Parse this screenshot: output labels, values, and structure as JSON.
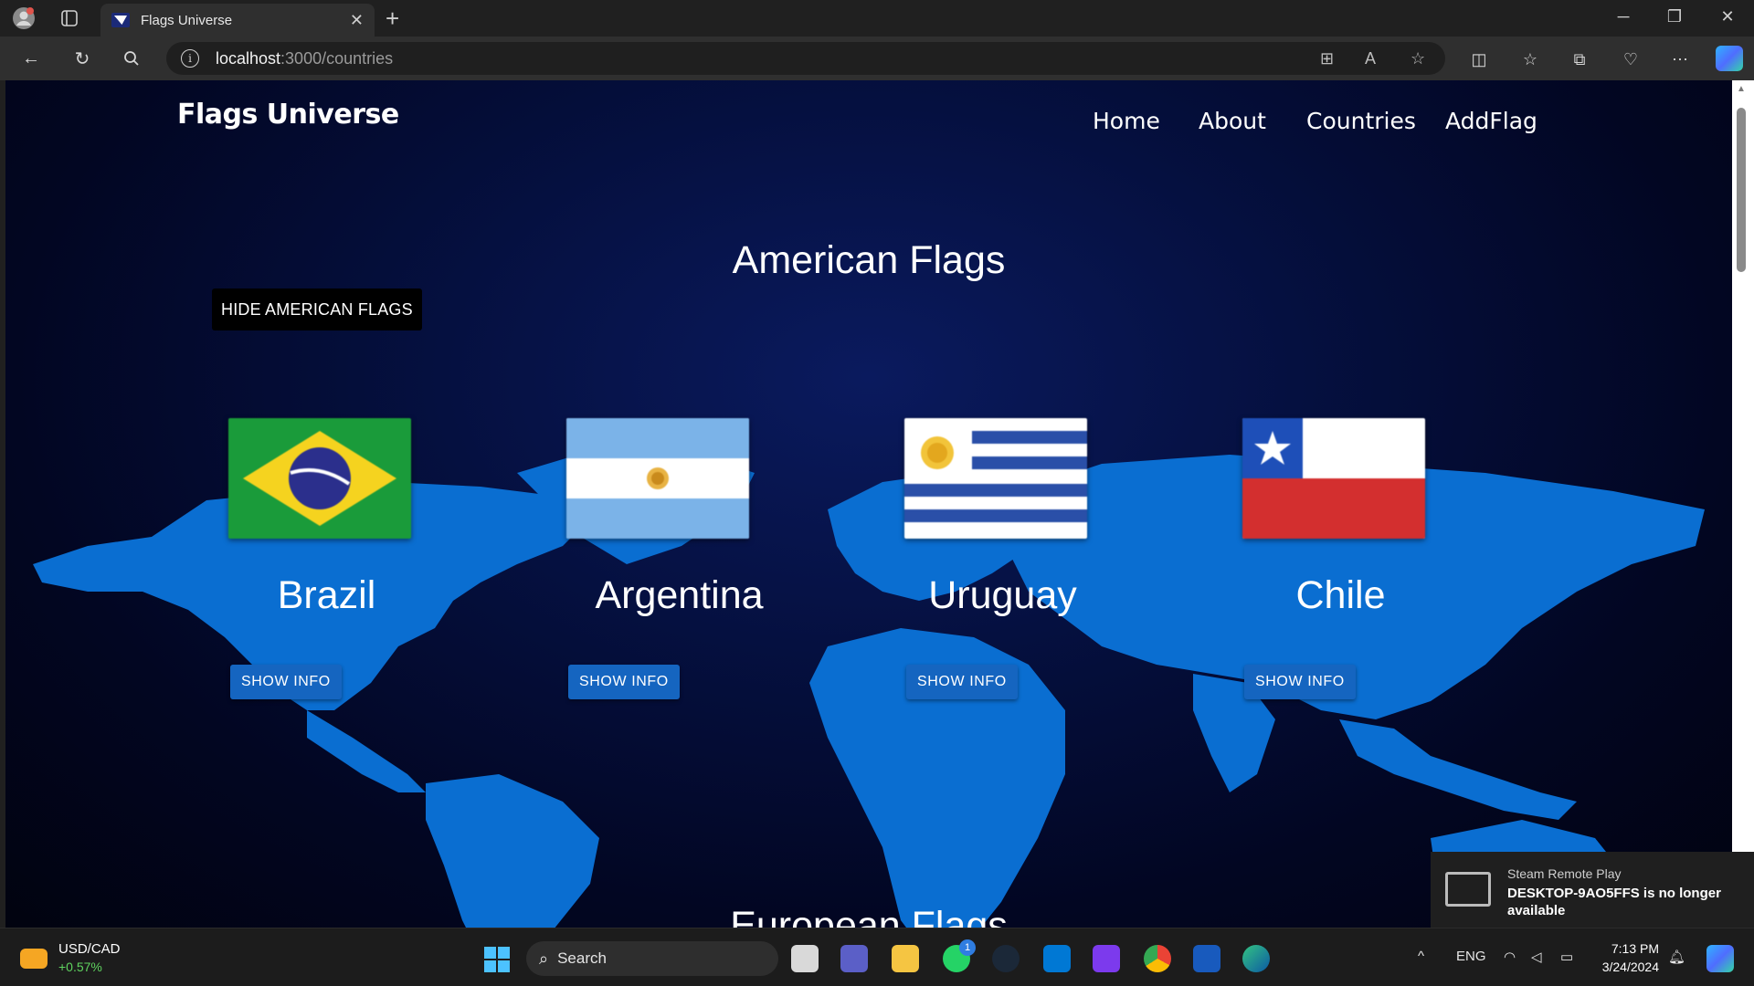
{
  "browser": {
    "tab_title": "Flags Universe",
    "url_host": "localhost",
    "url_path": ":3000/countries"
  },
  "site": {
    "brand": "Flags Universe",
    "nav": [
      "Home",
      "About",
      "Countries",
      "AddFlag"
    ]
  },
  "section": {
    "title": "American Flags",
    "hide_button": "HIDE AMERICAN FLAGS",
    "next_title": "European Flags"
  },
  "countries": [
    {
      "name": "Brazil",
      "button": "SHOW INFO"
    },
    {
      "name": "Argentina",
      "button": "SHOW INFO"
    },
    {
      "name": "Uruguay",
      "button": "SHOW INFO"
    },
    {
      "name": "Chile",
      "button": "SHOW INFO"
    }
  ],
  "toast": {
    "title": "Steam Remote Play",
    "body": "DESKTOP-9AO5FFS is no longer available"
  },
  "taskbar": {
    "stock_name": "USD/CAD",
    "stock_change": "+0.57%",
    "search_placeholder": "Search",
    "language": "ENG",
    "time": "7:13 PM",
    "date": "3/24/2024",
    "whatsapp_badge": "1"
  },
  "colors": {
    "map_blue": "#0a6ed1",
    "button_blue": "#1565c0",
    "page_bg": "#020622"
  }
}
